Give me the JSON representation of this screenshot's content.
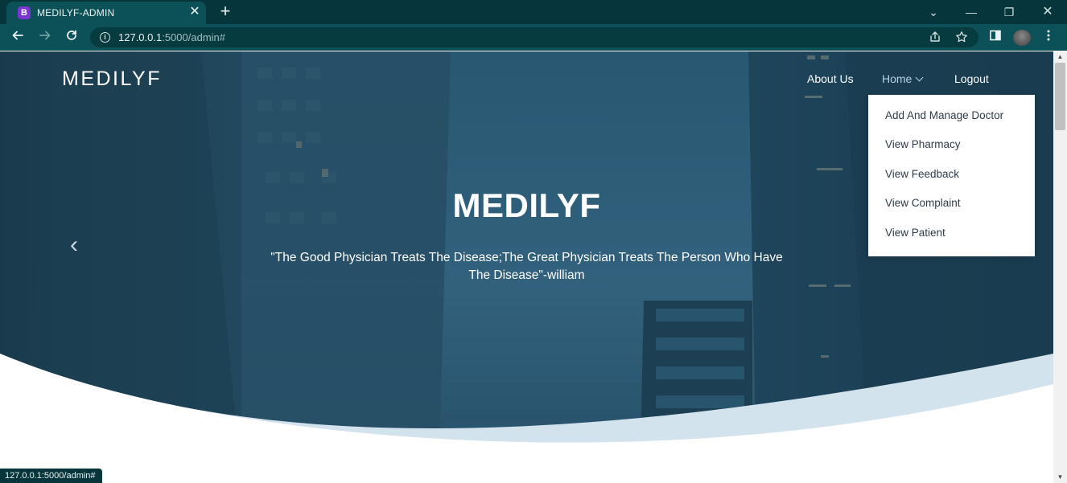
{
  "browser": {
    "tab": {
      "favicon_letter": "B",
      "title": "MEDILYF-ADMIN",
      "close_glyph": "✕"
    },
    "new_tab_glyph": "+",
    "window_controls": {
      "dropdown": "⌄",
      "minimize": "—",
      "restore": "❐",
      "close": "✕"
    },
    "url_host": "127.0.0.1",
    "url_rest": ":5000/admin#",
    "status_url": "127.0.0.1:5000/admin#",
    "icons": [
      "back-icon",
      "forward-icon",
      "reload-icon",
      "site-info-icon",
      "share-icon",
      "bookmark-star-icon",
      "side-panel-icon",
      "profile-avatar",
      "kebab-menu-icon"
    ]
  },
  "navbar": {
    "brand": "MEDILYF",
    "links": {
      "about": "About Us",
      "home": "Home",
      "logout": "Logout"
    }
  },
  "dropdown": {
    "items": [
      "Add And Manage Doctor",
      "View Pharmacy",
      "View Feedback",
      "View Complaint",
      "View Patient"
    ]
  },
  "hero": {
    "title": "MEDILYF",
    "quote_line1": "\"The Good Physician Treats The Disease;The Great Physician Treats The Person Who Have",
    "quote_line2": "The Disease\"-william",
    "prev_glyph": "‹"
  },
  "colors": {
    "chrome_dark": "#06363c",
    "chrome_toolbar": "#0b5157",
    "hero_overlay": "#1f4a63",
    "wave_light": "#d3e3ee",
    "nav_active": "#b6d4e4",
    "dropdown_text": "#2e3c48"
  }
}
